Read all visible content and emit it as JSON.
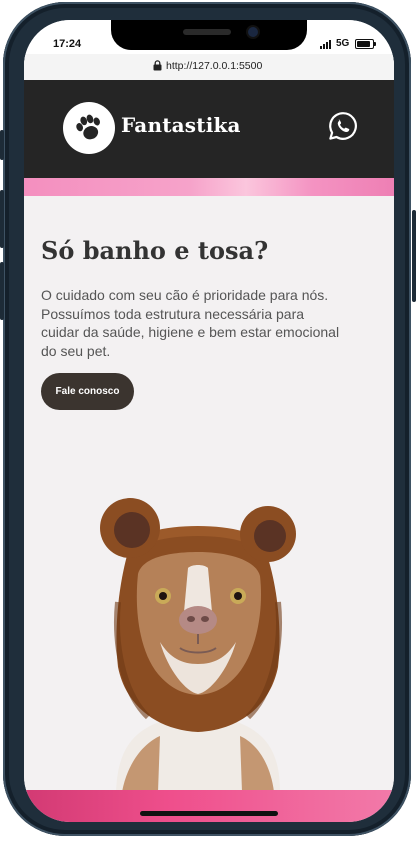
{
  "status_bar": {
    "time": "17:24",
    "network": "5G"
  },
  "browser": {
    "url": "http://127.0.0.1:5500"
  },
  "header": {
    "brand": "Fantastika",
    "logo_icon": "paw-icon",
    "contact_icon": "whatsapp-icon"
  },
  "hero": {
    "title": "Só banho e tosa?",
    "text": "O cuidado com seu cão é prioridade para nós. Possuímos toda estrutura necessária para cuidar da saúde, higiene e bem estar emocional do seu pet.",
    "button_label": "Fale conosco",
    "image": "dog-in-bear-costume"
  },
  "colors": {
    "header_bg": "#252525",
    "accent_pink": "#ef4f8c",
    "button_bg": "#3b342f",
    "page_bg": "#f3f1f2"
  }
}
